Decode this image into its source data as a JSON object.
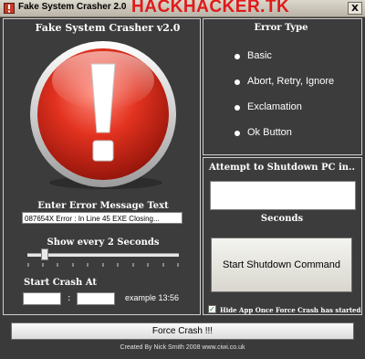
{
  "window": {
    "title": "Fake System Crasher 2.0",
    "watermark": "HACKHACKER.TK",
    "close_label": "X"
  },
  "app": {
    "heading": "Fake System Crasher v2.0",
    "icon": "exclamation-icon"
  },
  "error_message": {
    "label": "Enter Error Message Text",
    "value": "087654X Error : In Line 45 EXE Closing..."
  },
  "interval": {
    "label": "Show every 2 Seconds",
    "slider_value": 2
  },
  "start_crash": {
    "label": "Start Crash At",
    "hour_value": "",
    "minute_value": "",
    "separator": ":",
    "example": "example 13:56"
  },
  "error_type": {
    "label": "Error Type",
    "options": [
      "Basic",
      "Abort, Retry, Ignore",
      "Exclamation",
      "Ok Button"
    ]
  },
  "shutdown": {
    "label": "Attempt to Shutdown PC in..",
    "seconds_value": "",
    "seconds_label": "Seconds",
    "button_label": "Start Shutdown Command"
  },
  "hide_app": {
    "checked": true,
    "label": "Hide App Once Force Crash has started"
  },
  "force_crash": {
    "button_label": "Force Crash !!!"
  },
  "footer": {
    "credits": "Created By Nick Smith 2008  www.ciwi.co.uk"
  }
}
